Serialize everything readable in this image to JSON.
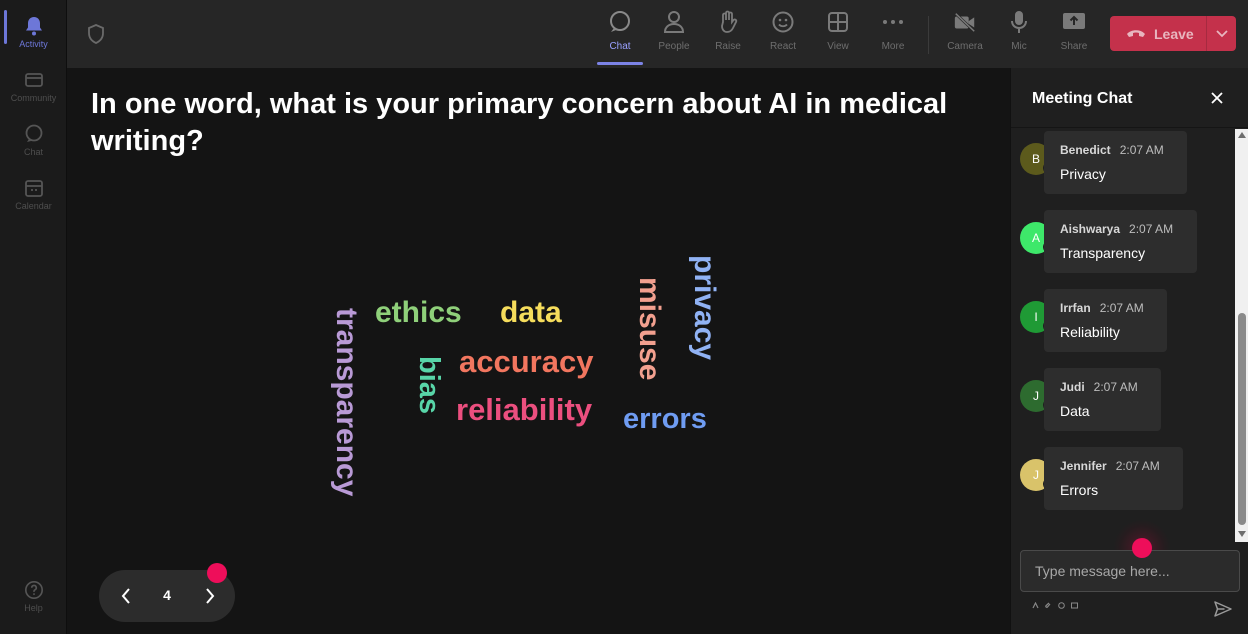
{
  "rail": {
    "items": [
      {
        "label": "Activity",
        "icon": "bell-icon",
        "active": true
      },
      {
        "label": "Community",
        "icon": "community-icon"
      },
      {
        "label": "Chat",
        "icon": "chat-icon"
      },
      {
        "label": "Calendar",
        "icon": "calendar-icon"
      },
      {
        "label": "Help",
        "icon": "help-icon"
      }
    ]
  },
  "toolbar": {
    "chat": "Chat",
    "people": "People",
    "raise": "Raise",
    "react": "React",
    "view": "View",
    "more": "More",
    "camera": "Camera",
    "mic": "Mic",
    "share": "Share",
    "leave": "Leave"
  },
  "stage": {
    "question": "In one word, what is your primary concern about AI in medical writing?",
    "words": [
      {
        "text": "ethics",
        "color": "#8fd07a"
      },
      {
        "text": "data",
        "color": "#f6dd5c"
      },
      {
        "text": "accuracy",
        "color": "#f2765f"
      },
      {
        "text": "reliability",
        "color": "#ec4f7f"
      },
      {
        "text": "errors",
        "color": "#6f9cf2"
      },
      {
        "text": "transparency",
        "color": "#b99ad6"
      },
      {
        "text": "bias",
        "color": "#58d5a8"
      },
      {
        "text": "misuse",
        "color": "#f2a08f"
      },
      {
        "text": "privacy",
        "color": "#90b2f4"
      }
    ],
    "page": "4"
  },
  "chat": {
    "title": "Meeting Chat",
    "messages": [
      {
        "initial": "B",
        "name": "Benedict",
        "time": "2:07 AM",
        "text": "Privacy",
        "avatar_color": "#5c5a1c"
      },
      {
        "initial": "A",
        "name": "Aishwarya",
        "time": "2:07 AM",
        "text": "Transparency",
        "avatar_color": "#3ee86a"
      },
      {
        "initial": "I",
        "name": "Irrfan",
        "time": "2:07 AM",
        "text": "Reliability",
        "avatar_color": "#1f9a35"
      },
      {
        "initial": "J",
        "name": "Judi",
        "time": "2:07 AM",
        "text": "Data",
        "avatar_color": "#2d6b2f"
      },
      {
        "initial": "J",
        "name": "Jennifer",
        "time": "2:07 AM",
        "text": "Errors",
        "avatar_color": "#d9c36a"
      }
    ],
    "input_placeholder": "Type message here..."
  }
}
